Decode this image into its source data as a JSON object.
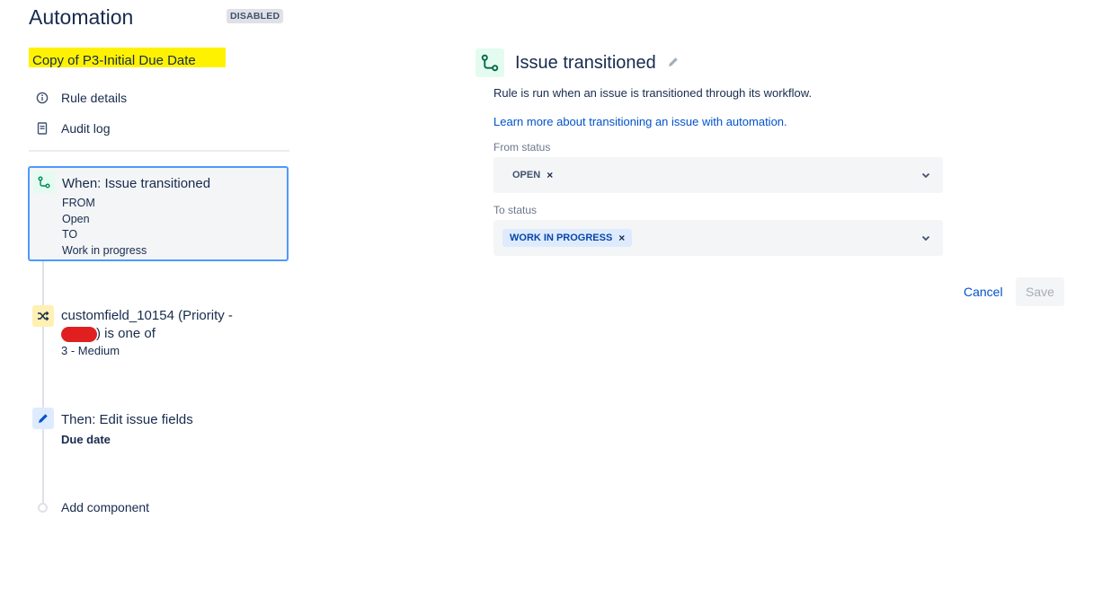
{
  "header": {
    "title": "Automation",
    "status_badge": "DISABLED"
  },
  "rule": {
    "name": "Copy of P3-Initial Due Date",
    "name_highlight_color": "#fff200"
  },
  "sidebar_nav": [
    {
      "label": "Rule details",
      "icon": "info-icon"
    },
    {
      "label": "Audit log",
      "icon": "document-icon"
    }
  ],
  "components": {
    "trigger": {
      "title": "When: Issue transitioned",
      "from_label": "FROM",
      "from_value": "Open",
      "to_label": "TO",
      "to_value": "Work in progress",
      "icon": "transition-icon"
    },
    "condition": {
      "text_before_redaction": "customfield_10154 (Priority -",
      "text_after_redaction": ") is one of",
      "value": "3 - Medium",
      "icon": "shuffle-icon"
    },
    "action": {
      "title": "Then: Edit issue fields",
      "field": "Due date",
      "icon": "pencil-icon"
    },
    "add_component_label": "Add component"
  },
  "detail": {
    "title": "Issue transitioned",
    "description": "Rule is run when an issue is transitioned through its workflow.",
    "learn_more": "Learn more about transitioning an issue with automation.",
    "from_status_label": "From status",
    "from_status_values": [
      "OPEN"
    ],
    "to_status_label": "To status",
    "to_status_values": [
      "WORK IN PROGRESS"
    ],
    "chip_remove": "×"
  },
  "buttons": {
    "cancel": "Cancel",
    "save": "Save"
  },
  "colors": {
    "accent": "#0052cc",
    "selected_border": "#4c9aff",
    "trigger_green": "#00875a",
    "redaction": "#e02020"
  }
}
